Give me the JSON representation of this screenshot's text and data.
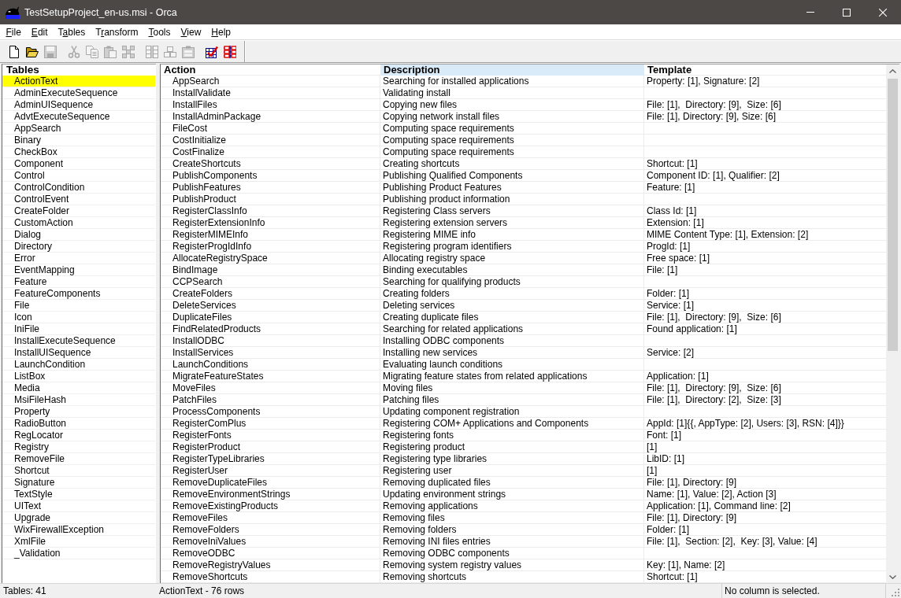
{
  "window": {
    "title": "TestSetupProject_en-us.msi - Orca"
  },
  "menu": [
    {
      "label": "File",
      "kind": "initial"
    },
    {
      "label": "Edit",
      "kind": "initial"
    },
    {
      "label": "Tables",
      "kind": "second"
    },
    {
      "label": "Transform",
      "kind": "second"
    },
    {
      "label": "Tools",
      "kind": "initial"
    },
    {
      "label": "View",
      "kind": "initial"
    },
    {
      "label": "Help",
      "kind": "initial"
    }
  ],
  "toolbar": {
    "groups": [
      {
        "buttons": [
          {
            "kind": "new",
            "disabled": false
          },
          {
            "kind": "open",
            "disabled": false
          },
          {
            "kind": "save",
            "disabled": true
          }
        ]
      },
      {
        "buttons": [
          {
            "kind": "cut",
            "disabled": true
          },
          {
            "kind": "copy",
            "disabled": true
          },
          {
            "kind": "paste",
            "disabled": true
          },
          {
            "kind": "delete",
            "disabled": true
          }
        ]
      },
      {
        "buttons": [
          {
            "kind": "cutrows",
            "disabled": true
          },
          {
            "kind": "copyrows",
            "disabled": true
          },
          {
            "kind": "pasterows",
            "disabled": true
          }
        ]
      },
      {
        "buttons": [
          {
            "kind": "validate",
            "disabled": false
          },
          {
            "kind": "tables",
            "disabled": false
          }
        ]
      }
    ]
  },
  "tables_pane": {
    "header": "Tables",
    "items": [
      {
        "name": "ActionText",
        "selected": true
      },
      {
        "name": "AdminExecuteSequence",
        "selected": false
      },
      {
        "name": "AdminUISequence",
        "selected": false
      },
      {
        "name": "AdvtExecuteSequence",
        "selected": false
      },
      {
        "name": "AppSearch",
        "selected": false
      },
      {
        "name": "Binary",
        "selected": false
      },
      {
        "name": "CheckBox",
        "selected": false
      },
      {
        "name": "Component",
        "selected": false
      },
      {
        "name": "Control",
        "selected": false
      },
      {
        "name": "ControlCondition",
        "selected": false
      },
      {
        "name": "ControlEvent",
        "selected": false
      },
      {
        "name": "CreateFolder",
        "selected": false
      },
      {
        "name": "CustomAction",
        "selected": false
      },
      {
        "name": "Dialog",
        "selected": false
      },
      {
        "name": "Directory",
        "selected": false
      },
      {
        "name": "Error",
        "selected": false
      },
      {
        "name": "EventMapping",
        "selected": false
      },
      {
        "name": "Feature",
        "selected": false
      },
      {
        "name": "FeatureComponents",
        "selected": false
      },
      {
        "name": "File",
        "selected": false
      },
      {
        "name": "Icon",
        "selected": false
      },
      {
        "name": "IniFile",
        "selected": false
      },
      {
        "name": "InstallExecuteSequence",
        "selected": false
      },
      {
        "name": "InstallUISequence",
        "selected": false
      },
      {
        "name": "LaunchCondition",
        "selected": false
      },
      {
        "name": "ListBox",
        "selected": false
      },
      {
        "name": "Media",
        "selected": false
      },
      {
        "name": "MsiFileHash",
        "selected": false
      },
      {
        "name": "Property",
        "selected": false
      },
      {
        "name": "RadioButton",
        "selected": false
      },
      {
        "name": "RegLocator",
        "selected": false
      },
      {
        "name": "Registry",
        "selected": false
      },
      {
        "name": "RemoveFile",
        "selected": false
      },
      {
        "name": "Shortcut",
        "selected": false
      },
      {
        "name": "Signature",
        "selected": false
      },
      {
        "name": "TextStyle",
        "selected": false
      },
      {
        "name": "UIText",
        "selected": false
      },
      {
        "name": "Upgrade",
        "selected": false
      },
      {
        "name": "WixFirewallException",
        "selected": false
      },
      {
        "name": "XmlFile",
        "selected": false
      },
      {
        "name": "_Validation",
        "selected": false
      }
    ]
  },
  "table": {
    "columns": [
      {
        "label": "Action",
        "highlighted": false
      },
      {
        "label": "Description",
        "highlighted": true
      },
      {
        "label": "Template",
        "highlighted": false
      }
    ],
    "rows": [
      {
        "action": "AppSearch",
        "description": "Searching for installed applications",
        "template": "Property: [1], Signature: [2]"
      },
      {
        "action": "InstallValidate",
        "description": "Validating install"
      },
      {
        "action": "InstallFiles",
        "description": "Copying new files",
        "template": "File: [1],  Directory: [9],  Size: [6]"
      },
      {
        "action": "InstallAdminPackage",
        "description": "Copying network install files",
        "template": "File: [1], Directory: [9], Size: [6]"
      },
      {
        "action": "FileCost",
        "description": "Computing space requirements"
      },
      {
        "action": "CostInitialize",
        "description": "Computing space requirements"
      },
      {
        "action": "CostFinalize",
        "description": "Computing space requirements"
      },
      {
        "action": "CreateShortcuts",
        "description": "Creating shortcuts",
        "template": "Shortcut: [1]"
      },
      {
        "action": "PublishComponents",
        "description": "Publishing Qualified Components",
        "template": "Component ID: [1], Qualifier: [2]"
      },
      {
        "action": "PublishFeatures",
        "description": "Publishing Product Features",
        "template": "Feature: [1]"
      },
      {
        "action": "PublishProduct",
        "description": "Publishing product information"
      },
      {
        "action": "RegisterClassInfo",
        "description": "Registering Class servers",
        "template": "Class Id: [1]"
      },
      {
        "action": "RegisterExtensionInfo",
        "description": "Registering extension servers",
        "template": "Extension: [1]"
      },
      {
        "action": "RegisterMIMEInfo",
        "description": "Registering MIME info",
        "template": "MIME Content Type: [1], Extension: [2]"
      },
      {
        "action": "RegisterProgIdInfo",
        "description": "Registering program identifiers",
        "template": "ProgId: [1]"
      },
      {
        "action": "AllocateRegistrySpace",
        "description": "Allocating registry space",
        "template": "Free space: [1]"
      },
      {
        "action": "BindImage",
        "description": "Binding executables",
        "template": "File: [1]"
      },
      {
        "action": "CCPSearch",
        "description": "Searching for qualifying products"
      },
      {
        "action": "CreateFolders",
        "description": "Creating folders",
        "template": "Folder: [1]"
      },
      {
        "action": "DeleteServices",
        "description": "Deleting services",
        "template": "Service: [1]"
      },
      {
        "action": "DuplicateFiles",
        "description": "Creating duplicate files",
        "template": "File: [1],  Directory: [9],  Size: [6]"
      },
      {
        "action": "FindRelatedProducts",
        "description": "Searching for related applications",
        "template": "Found application: [1]"
      },
      {
        "action": "InstallODBC",
        "description": "Installing ODBC components"
      },
      {
        "action": "InstallServices",
        "description": "Installing new services",
        "template": "Service: [2]"
      },
      {
        "action": "LaunchConditions",
        "description": "Evaluating launch conditions"
      },
      {
        "action": "MigrateFeatureStates",
        "description": "Migrating feature states from related applications",
        "template": "Application: [1]"
      },
      {
        "action": "MoveFiles",
        "description": "Moving files",
        "template": "File: [1],  Directory: [9],  Size: [6]"
      },
      {
        "action": "PatchFiles",
        "description": "Patching files",
        "template": "File: [1],  Directory: [2],  Size: [3]"
      },
      {
        "action": "ProcessComponents",
        "description": "Updating component registration"
      },
      {
        "action": "RegisterComPlus",
        "description": "Registering COM+ Applications and Components",
        "template": "AppId: [1]{{, AppType: [2], Users: [3], RSN: [4]}}"
      },
      {
        "action": "RegisterFonts",
        "description": "Registering fonts",
        "template": "Font: [1]"
      },
      {
        "action": "RegisterProduct",
        "description": "Registering product",
        "template": "[1]"
      },
      {
        "action": "RegisterTypeLibraries",
        "description": "Registering type libraries",
        "template": "LibID: [1]"
      },
      {
        "action": "RegisterUser",
        "description": "Registering user",
        "template": "[1]"
      },
      {
        "action": "RemoveDuplicateFiles",
        "description": "Removing duplicated files",
        "template": "File: [1], Directory: [9]"
      },
      {
        "action": "RemoveEnvironmentStrings",
        "description": "Updating environment strings",
        "template": "Name: [1], Value: [2], Action [3]"
      },
      {
        "action": "RemoveExistingProducts",
        "description": "Removing applications",
        "template": "Application: [1], Command line: [2]"
      },
      {
        "action": "RemoveFiles",
        "description": "Removing files",
        "template": "File: [1], Directory: [9]"
      },
      {
        "action": "RemoveFolders",
        "description": "Removing folders",
        "template": "Folder: [1]"
      },
      {
        "action": "RemoveIniValues",
        "description": "Removing INI files entries",
        "template": "File: [1],  Section: [2],  Key: [3], Value: [4]"
      },
      {
        "action": "RemoveODBC",
        "description": "Removing ODBC components"
      },
      {
        "action": "RemoveRegistryValues",
        "description": "Removing system registry values",
        "template": "Key: [1], Name: [2]"
      },
      {
        "action": "RemoveShortcuts",
        "description": "Removing shortcuts",
        "template": "Shortcut: [1]"
      }
    ]
  },
  "status_bar": {
    "tables_count": "Tables: 41",
    "table_info": "ActionText - 76 rows",
    "column_info": "No column is selected."
  }
}
